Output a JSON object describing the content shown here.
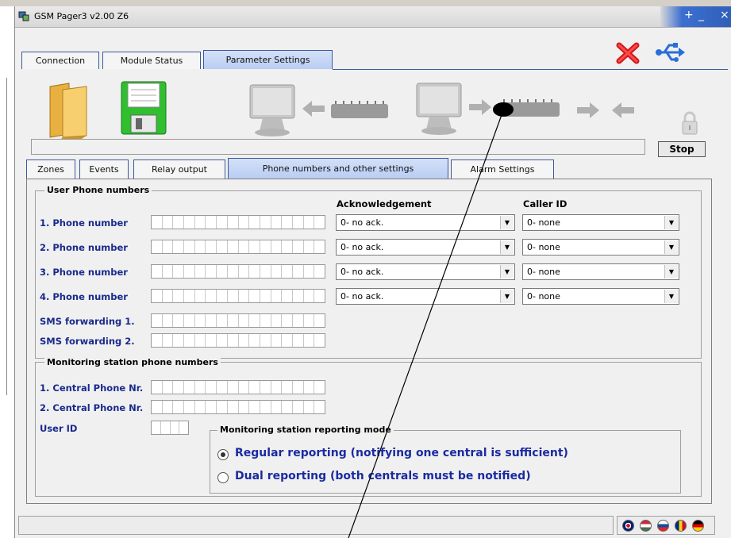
{
  "window": {
    "title": "GSM Pager3  v2.00 Z6"
  },
  "main_tabs": [
    {
      "label": "Connection"
    },
    {
      "label": "Module Status"
    },
    {
      "label": "Parameter Settings"
    }
  ],
  "toolbar": {
    "stop_label": "Stop",
    "icons": [
      "folder-icon",
      "floppy-save-icon",
      "pc-to-module-icon",
      "module-to-pc-icon",
      "lock-icon",
      "close-x-icon",
      "usb-icon"
    ]
  },
  "sub_tabs": [
    {
      "label": "Zones"
    },
    {
      "label": "Events"
    },
    {
      "label": "Relay output"
    },
    {
      "label": "Phone numbers and other settings"
    },
    {
      "label": "Alarm Settings"
    }
  ],
  "user_phones": {
    "title": "User Phone numbers",
    "ack_header": "Acknowledgement",
    "callerid_header": "Caller ID",
    "rows": [
      {
        "label": "1. Phone number",
        "ack": "0- no ack.",
        "callerid": "0- none"
      },
      {
        "label": "2. Phone number",
        "ack": "0- no ack.",
        "callerid": "0- none"
      },
      {
        "label": "3. Phone number",
        "ack": "0- no ack.",
        "callerid": "0- none"
      },
      {
        "label": "4. Phone number",
        "ack": "0- no ack.",
        "callerid": "0- none"
      }
    ],
    "sms": [
      {
        "label": "SMS forwarding 1."
      },
      {
        "label": "SMS forwarding 2."
      }
    ]
  },
  "monitoring": {
    "title": "Monitoring station phone numbers",
    "central1_label": "1. Central Phone Nr.",
    "central2_label": "2. Central Phone Nr.",
    "userid_label": "User ID",
    "mode_title": "Monitoring station reporting mode",
    "options": [
      {
        "label": "Regular reporting (notifying one central is sufficient)",
        "selected": true
      },
      {
        "label": "Dual reporting (both centrals must be notified)",
        "selected": false
      }
    ]
  },
  "colors": {
    "label_blue": "#1a2a8c",
    "tab_border": "#3b5998",
    "active_tab": "#b9cdf3"
  }
}
